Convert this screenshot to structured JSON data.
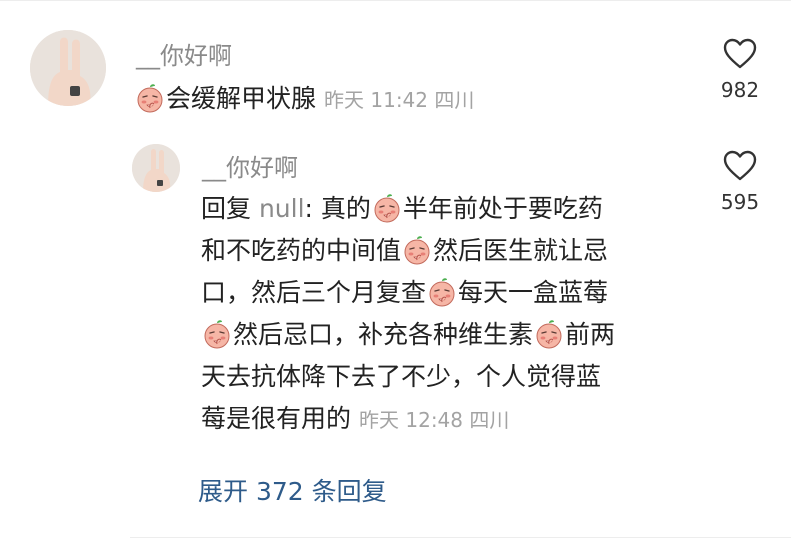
{
  "comment": {
    "username": "__你好啊",
    "text": [
      {
        "emoji": "blush-emoji"
      },
      {
        "t": "会缓解甲状腺"
      }
    ],
    "time": "昨天 11:42",
    "location": "四川",
    "likes": "982"
  },
  "reply": {
    "username": "__你好啊",
    "reply_label": "回复",
    "reply_target": "null",
    "lines": [
      [
        {
          "t": "回复 "
        },
        {
          "t": "null",
          "cls": "reply-to"
        },
        {
          "t": ": 真的"
        },
        {
          "emoji": "blush-emoji"
        },
        {
          "t": "半年前处于要吃药"
        }
      ],
      [
        {
          "t": "和不吃药的中间值"
        },
        {
          "emoji": "blush-emoji"
        },
        {
          "t": "然后医生就让忌"
        }
      ],
      [
        {
          "t": "口，然后三个月复查"
        },
        {
          "emoji": "blush-emoji"
        },
        {
          "t": "每天一盒蓝莓"
        }
      ],
      [
        {
          "emoji": "blush-emoji"
        },
        {
          "t": "然后忌口，补充各种维生素"
        },
        {
          "emoji": "blush-emoji"
        },
        {
          "t": "前两"
        }
      ],
      [
        {
          "t": "天去抗体降下去了不少，个人觉得蓝"
        }
      ],
      [
        {
          "t": "莓是很有用的"
        },
        {
          "meta": "昨天 12:48 四川"
        }
      ]
    ],
    "time": "昨天 12:48",
    "location": "四川",
    "likes": "595"
  },
  "expand_label": "展开 372 条回复",
  "colors": {
    "link": "#2e5b8a",
    "muted": "#8a8a8a",
    "meta": "#a3a3a3"
  }
}
